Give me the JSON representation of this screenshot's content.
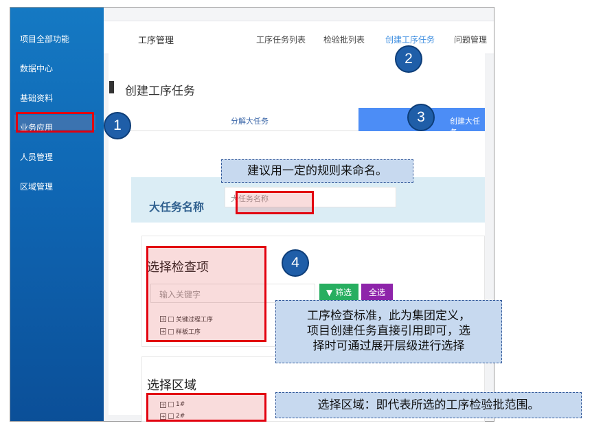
{
  "sidebar": {
    "items": [
      {
        "label": "项目全部功能"
      },
      {
        "label": "数据中心"
      },
      {
        "label": "基础资料"
      },
      {
        "label": "业务应用"
      },
      {
        "label": "人员管理"
      },
      {
        "label": "区域管理"
      }
    ],
    "active_index": 3
  },
  "navbar": {
    "title": "工序管理",
    "links": [
      {
        "label": "工序任务列表"
      },
      {
        "label": "检验批列表"
      },
      {
        "label": "创建工序任务"
      },
      {
        "label": "问题管理"
      }
    ],
    "active_index": 2
  },
  "page": {
    "title": "创建工序任务",
    "tabs": [
      {
        "label": "分解大任务"
      },
      {
        "label": "创建大任务"
      }
    ],
    "active_tab": 1
  },
  "form": {
    "name_label": "大任务名称",
    "name_placeholder": "大任务名称",
    "check_section_title": "选择检查项",
    "keyword_placeholder": "输入关键字",
    "filter_button": "筛选",
    "select_all_button": "全选",
    "check_tree": [
      {
        "label": "关键过程工序"
      },
      {
        "label": "样板工序"
      }
    ],
    "area_section_title": "选择区域",
    "area_tree": [
      {
        "label": "1#"
      },
      {
        "label": "2#"
      }
    ]
  },
  "annotations": {
    "badges": [
      "1",
      "2",
      "3",
      "4"
    ],
    "callout_name": "建议用一定的规则来命名。",
    "callout_check": [
      "工序检查标准，此为集团定义，",
      "项目创建任务直接引用即可，选",
      "择时可通过展开层级进行选择"
    ],
    "callout_area": "选择区域：即代表所选的工序检验批范围。"
  },
  "colors": {
    "sidebar_blue": "#1579c3",
    "active_tab_blue": "#4c8df6",
    "filter_green": "#27ae60",
    "select_all_purple": "#8e24aa",
    "highlight_red": "#e2000f",
    "badge_blue": "#1f5ea8"
  },
  "icons": {
    "filter": "funnel-icon",
    "tree_expand": "plus-square-icon",
    "tree_check": "checkbox-icon"
  }
}
